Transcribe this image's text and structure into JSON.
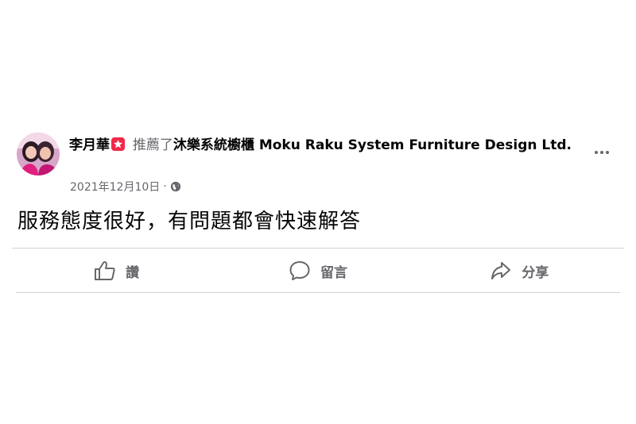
{
  "post": {
    "author": "李月華",
    "action_text": "推薦了",
    "page_name": "沐樂系統櫥櫃 Moku Raku System Furniture Design Ltd.",
    "date": "2021年12月10日",
    "separator": "·",
    "body": "服務態度很好，有問題都會快速解答"
  },
  "actions": {
    "like_label": "讚",
    "comment_label": "留言",
    "share_label": "分享"
  },
  "icons": {
    "avatar": "avatar-photo",
    "badge": "recommend-star-icon",
    "privacy": "globe-icon",
    "more": "more-options-icon",
    "like": "thumbs-up-icon",
    "comment": "comment-bubble-icon",
    "share": "share-arrow-icon"
  },
  "colors": {
    "text_primary": "#050505",
    "text_secondary": "#65676b",
    "badge": "#f02849",
    "divider": "#ced0d4"
  }
}
